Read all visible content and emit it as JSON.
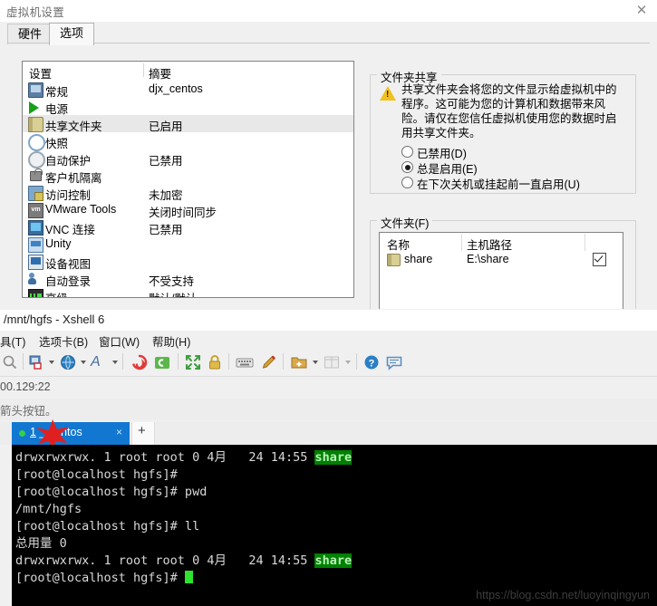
{
  "vm_dialog": {
    "title": "虚拟机设置",
    "close_label": "✕",
    "tabs": [
      {
        "label": "硬件",
        "active": false
      },
      {
        "label": "选项",
        "active": true
      }
    ],
    "list": {
      "headers": {
        "setting": "设置",
        "summary": "摘要"
      },
      "rows": [
        {
          "icon": "monitor-icon",
          "label": "常规",
          "summary": "djx_centos",
          "selected": false
        },
        {
          "icon": "power-play-icon",
          "label": "电源",
          "summary": "",
          "selected": false
        },
        {
          "icon": "folder-icon",
          "label": "共享文件夹",
          "summary": "已启用",
          "selected": true
        },
        {
          "icon": "snapshot-icon",
          "label": "快照",
          "summary": "",
          "selected": false
        },
        {
          "icon": "autoprotect-icon",
          "label": "自动保护",
          "summary": "已禁用",
          "selected": false
        },
        {
          "icon": "lock-icon",
          "label": "客户机隔离",
          "summary": "",
          "selected": false
        },
        {
          "icon": "access-key-icon",
          "label": "访问控制",
          "summary": "未加密",
          "selected": false
        },
        {
          "icon": "vmware-tools-icon",
          "label": "VMware Tools",
          "summary": "关闭时间同步",
          "selected": false
        },
        {
          "icon": "vnc-icon",
          "label": "VNC 连接",
          "summary": "已禁用",
          "selected": false
        },
        {
          "icon": "unity-icon",
          "label": "Unity",
          "summary": "",
          "selected": false
        },
        {
          "icon": "device-view-icon",
          "label": "设备视图",
          "summary": "",
          "selected": false
        },
        {
          "icon": "autologon-icon",
          "label": "自动登录",
          "summary": "不受支持",
          "selected": false
        },
        {
          "icon": "advanced-icon",
          "label": "高级",
          "summary": "默认/默认",
          "selected": false
        }
      ]
    },
    "share_group": {
      "legend": "文件夹共享",
      "warning_icon": "warning-triangle-icon",
      "warning_text": "共享文件夹会将您的文件显示给虚拟机中的程序。这可能为您的计算机和数据带来风险。请仅在您信任虚拟机使用您的数据时启用共享文件夹。",
      "options": [
        {
          "label": "已禁用(D)",
          "selected": false
        },
        {
          "label": "总是启用(E)",
          "selected": true
        },
        {
          "label": "在下次关机或挂起前一直启用(U)",
          "selected": false
        }
      ]
    },
    "folders_group": {
      "legend": "文件夹(F)",
      "columns": [
        "名称",
        "主机路径"
      ],
      "rows": [
        {
          "icon": "folder-icon",
          "name": "share",
          "host_path": "E:\\share",
          "enabled": true
        }
      ]
    }
  },
  "xshell": {
    "title": "/mnt/hgfs - Xshell 6",
    "menu_items": [
      "具(T)",
      "选项卡(B)",
      "窗口(W)",
      "帮助(H)"
    ],
    "toolbar_icons": [
      "search-icon",
      "new-session-icon",
      "chevron-down-icon",
      "globe-icon",
      "chevron-down-icon",
      "font-icon",
      "chevron-down-icon",
      "spiral-red-icon",
      "green-record-icon",
      "fullscreen-icon",
      "lock-icon",
      "keyboard-icon",
      "pen-highlight-icon",
      "add-folder-icon",
      "chevron-down-icon",
      "layout-icon",
      "chevron-down-icon",
      "help-icon",
      "chat-icon"
    ],
    "address_text": "00.129:22",
    "hint_text": "箭头按钮。",
    "tab": {
      "index_label": "1",
      "session_name": "centos",
      "close_label": "×",
      "status": "connected"
    },
    "new_tab_label": "+",
    "terminal_lines": [
      {
        "text": "drwxrwxrwx. 1 root root 0 4月   24 14:55 ",
        "dir": "share"
      },
      {
        "text": "[root@localhost hgfs]# ",
        "dir": ""
      },
      {
        "text": "[root@localhost hgfs]# pwd",
        "dir": ""
      },
      {
        "text": "/mnt/hgfs",
        "dir": ""
      },
      {
        "text": "[root@localhost hgfs]# ll",
        "dir": ""
      },
      {
        "text": "总用量 0",
        "dir": ""
      },
      {
        "text": "drwxrwxrwx. 1 root root 0 4月   24 14:55 ",
        "dir": "share"
      },
      {
        "text": "[root@localhost hgfs]# ",
        "dir": "",
        "cursor": true
      }
    ],
    "watermark": "https://blog.csdn.net/luoyinqingyun"
  },
  "colors": {
    "accent_blue": "#1177d1",
    "selection_gray": "#e8e8e8",
    "terminal_bg": "#000000",
    "dir_green": "#008000",
    "cursor_green": "#2ee22e",
    "warning_yellow": "#f2c11e"
  }
}
